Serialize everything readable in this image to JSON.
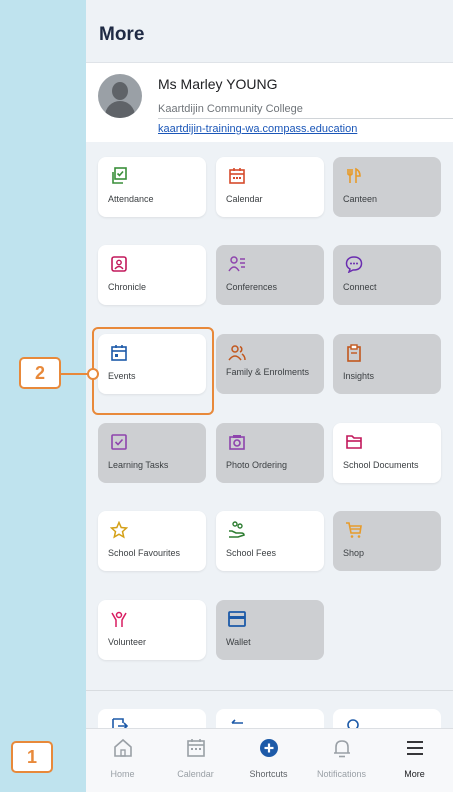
{
  "header": {
    "title": "More"
  },
  "profile": {
    "name": "Ms Marley YOUNG",
    "school": "Kaartdijin Community College",
    "link": "kaartdijin-training-wa.compass.education"
  },
  "tiles": [
    {
      "label": "Attendance",
      "icon": "attendance-icon",
      "color": "#3a8f3a",
      "disabled": false
    },
    {
      "label": "Calendar",
      "icon": "calendar-icon",
      "color": "#d64b2c",
      "disabled": false
    },
    {
      "label": "Canteen",
      "icon": "cutlery-icon",
      "color": "#e79b2b",
      "disabled": true
    },
    {
      "label": "Chronicle",
      "icon": "chronicle-icon",
      "color": "#c2185b",
      "disabled": false
    },
    {
      "label": "Conferences",
      "icon": "conferences-icon",
      "color": "#8e44ad",
      "disabled": true
    },
    {
      "label": "Connect",
      "icon": "chat-bubble-icon",
      "color": "#6a2cb0",
      "disabled": true
    },
    {
      "label": "Events",
      "icon": "events-calendar-icon",
      "color": "#1d5aa8",
      "disabled": false
    },
    {
      "label": "Family & Enrolments",
      "icon": "family-icon",
      "color": "#c2571d",
      "disabled": true
    },
    {
      "label": "Insights",
      "icon": "clipboard-icon",
      "color": "#c2571d",
      "disabled": true
    },
    {
      "label": "Learning Tasks",
      "icon": "task-checkbox-icon",
      "color": "#8e44ad",
      "disabled": true
    },
    {
      "label": "Photo Ordering",
      "icon": "camera-icon",
      "color": "#8e44ad",
      "disabled": true
    },
    {
      "label": "School Documents",
      "icon": "folder-icon",
      "color": "#c2185b",
      "disabled": false
    },
    {
      "label": "School Favourites",
      "icon": "star-icon",
      "color": "#d4a017",
      "disabled": false
    },
    {
      "label": "School Fees",
      "icon": "fees-icon",
      "color": "#2e7d32",
      "disabled": false
    },
    {
      "label": "Shop",
      "icon": "cart-icon",
      "color": "#e79b2b",
      "disabled": true
    },
    {
      "label": "Volunteer",
      "icon": "volunteer-icon",
      "color": "#d81b60",
      "disabled": false
    },
    {
      "label": "Wallet",
      "icon": "wallet-icon",
      "color": "#1d5aa8",
      "disabled": true
    }
  ],
  "tabs": [
    {
      "label": "Home",
      "icon": "home-icon"
    },
    {
      "label": "Calendar",
      "icon": "calendar-icon"
    },
    {
      "label": "Shortcuts",
      "icon": "plus-circle-icon"
    },
    {
      "label": "Notifications",
      "icon": "bell-icon"
    },
    {
      "label": "More",
      "icon": "menu-icon"
    }
  ],
  "callouts": {
    "one": "1",
    "two": "2"
  },
  "colors": {
    "accent": "#e8893a",
    "brand": "#1d5aa8"
  }
}
